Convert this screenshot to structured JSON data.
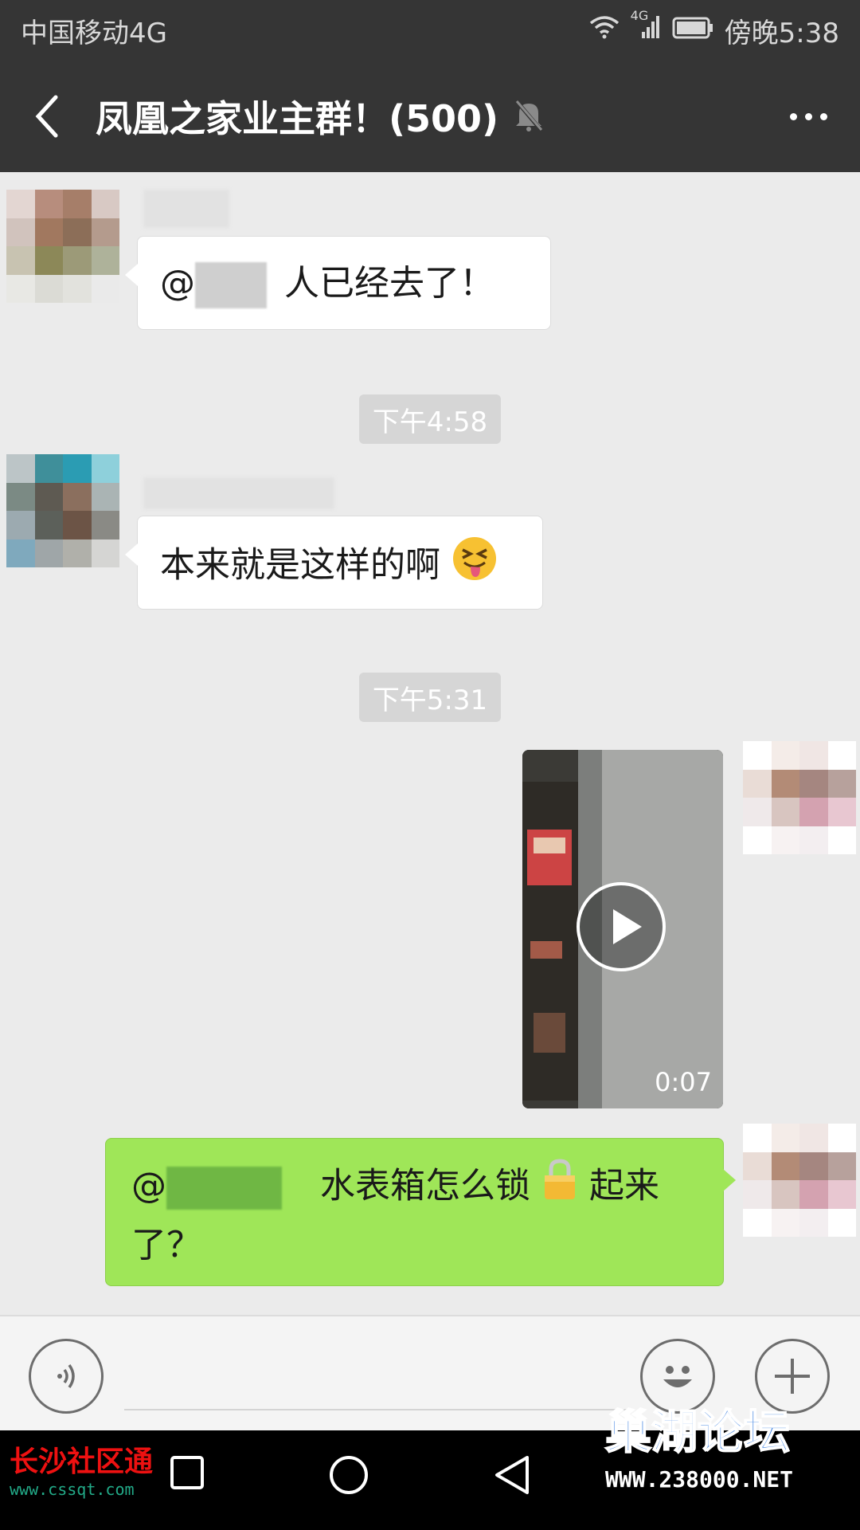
{
  "status_bar": {
    "carrier": "中国移动4G",
    "network_tag": "4G",
    "time": "傍晚5:38"
  },
  "header": {
    "title": "凤凰之家业主群！(500)",
    "muted": true
  },
  "messages": [
    {
      "side": "left",
      "text_prefix": "@",
      "text_suffix": "人已经去了！"
    },
    {
      "type": "time",
      "text": "下午4:58"
    },
    {
      "side": "left",
      "text": "本来就是这样的啊",
      "emoji": "squinting-tongue"
    },
    {
      "type": "time",
      "text": "下午5:31"
    },
    {
      "side": "right",
      "type": "video",
      "duration": "0:07"
    },
    {
      "side": "right",
      "text_prefix": "@",
      "text_mid": "水表箱怎么锁",
      "text_end": "起来",
      "text_line2": "了？"
    }
  ],
  "watermarks": {
    "left_title": "长沙社区通",
    "left_url": "www.cssqt.com",
    "right_title": "巢湖论坛",
    "right_url": "WWW.238000.NET"
  },
  "colors": {
    "bar": "#353535",
    "chat_bg": "#ebebeb",
    "own_bubble": "#9fe658"
  }
}
